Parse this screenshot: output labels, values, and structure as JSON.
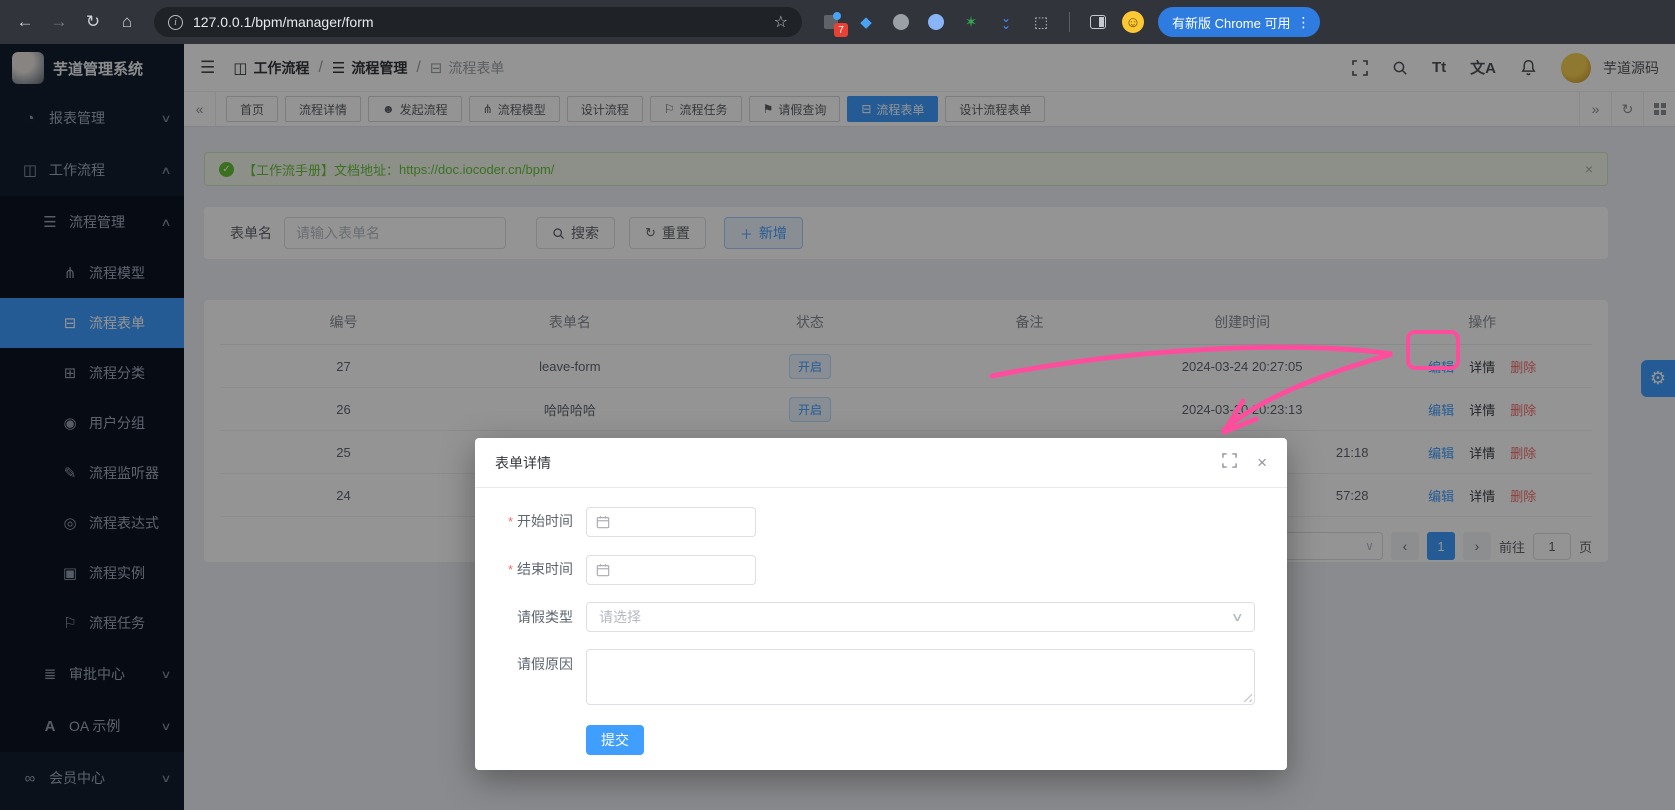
{
  "colors": {
    "primary": "#409eff",
    "danger": "#f56c6c",
    "success": "#67c23a",
    "annotation": "#ff4d9e"
  },
  "chrome": {
    "url": "127.0.0.1/bpm/manager/form",
    "update_label": "有新版 Chrome 可用",
    "extension_badge": "7"
  },
  "header": {
    "logo_title": "芋道管理系统",
    "breadcrumb": [
      "工作流程",
      "流程管理",
      "流程表单"
    ],
    "font_icon_label": "Tt",
    "translate_icon_label": "文A",
    "user_name": "芋道源码"
  },
  "tabs": {
    "items": [
      "首页",
      "流程详情",
      "发起流程",
      "流程模型",
      "设计流程",
      "流程任务",
      "请假查询",
      "流程表单",
      "设计流程表单"
    ],
    "active": "流程表单"
  },
  "sidebar": {
    "items": [
      {
        "label": "报表管理",
        "icon": "pie-chart"
      },
      {
        "label": "工作流程",
        "icon": "workflow-map"
      },
      {
        "label": "流程管理",
        "icon": "process-list"
      },
      {
        "label": "流程模型",
        "icon": "model-nodes"
      },
      {
        "label": "流程表单",
        "icon": "form-box",
        "active": true
      },
      {
        "label": "流程分类",
        "icon": "category"
      },
      {
        "label": "用户分组",
        "icon": "user-group"
      },
      {
        "label": "流程监听器",
        "icon": "listener-pen"
      },
      {
        "label": "流程表达式",
        "icon": "expression-scope"
      },
      {
        "label": "流程实例",
        "icon": "instance-square"
      },
      {
        "label": "流程任务",
        "icon": "task-bookmark"
      },
      {
        "label": "审批中心",
        "icon": "approval-list"
      },
      {
        "label": "OA 示例",
        "icon": "oa-letter"
      },
      {
        "label": "会员中心",
        "icon": "member-bike"
      }
    ]
  },
  "alert": {
    "prefix": "【工作流手册】文档地址：",
    "link": "https://doc.iocoder.cn/bpm/"
  },
  "search": {
    "field_label": "表单名",
    "placeholder": "请输入表单名",
    "search_label": "搜索",
    "reset_label": "重置",
    "add_label": "新增"
  },
  "table": {
    "headers": [
      "编号",
      "表单名",
      "状态",
      "备注",
      "创建时间",
      "操作"
    ],
    "rows": [
      {
        "id": "27",
        "name": "leave-form",
        "status": "开启",
        "remark": "",
        "created": "2024-03-24 20:27:05"
      },
      {
        "id": "26",
        "name": "哈哈哈哈",
        "status": "开启",
        "remark": "",
        "created": "2024-03-20 20:23:13"
      },
      {
        "id": "25",
        "name": "",
        "status": "",
        "remark": "",
        "created": "21:18"
      },
      {
        "id": "24",
        "name": "",
        "status": "",
        "remark": "",
        "created": "57:28"
      }
    ],
    "actions": {
      "edit": "编辑",
      "detail": "详情",
      "delete": "删除"
    }
  },
  "pagination": {
    "current_page": "1",
    "goto_label": "前往",
    "goto_value": "1",
    "unit_label": "页"
  },
  "modal": {
    "title": "表单详情",
    "fields": {
      "start": {
        "label": "开始时间",
        "required": true
      },
      "end": {
        "label": "结束时间",
        "required": true
      },
      "type": {
        "label": "请假类型",
        "placeholder": "请选择"
      },
      "reason": {
        "label": "请假原因"
      }
    },
    "submit_label": "提交"
  }
}
